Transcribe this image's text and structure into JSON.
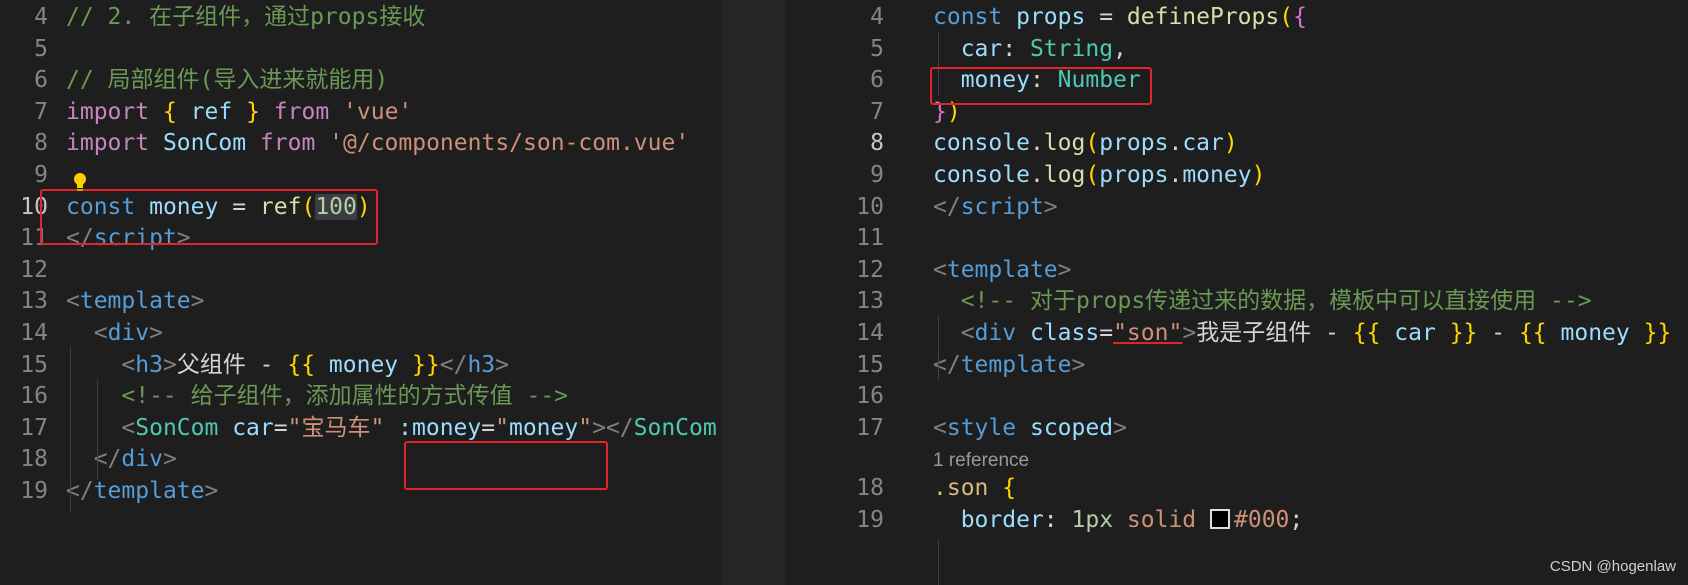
{
  "left": {
    "lines": [
      {
        "n": "4",
        "parts": [
          [
            "cmt",
            "// 2. 在子组件，通过props接收"
          ]
        ]
      },
      {
        "n": "5",
        "parts": []
      },
      {
        "n": "6",
        "parts": [
          [
            "cmt",
            "// 局部组件(导入进来就能用)"
          ]
        ]
      },
      {
        "n": "7",
        "parts": [
          [
            "ctl",
            "import"
          ],
          [
            "plain",
            " "
          ],
          [
            "br1",
            "{"
          ],
          [
            "plain",
            " "
          ],
          [
            "var",
            "ref"
          ],
          [
            "plain",
            " "
          ],
          [
            "br1",
            "}"
          ],
          [
            "plain",
            " "
          ],
          [
            "ctl",
            "from"
          ],
          [
            "plain",
            " "
          ],
          [
            "str",
            "'vue'"
          ]
        ]
      },
      {
        "n": "8",
        "parts": [
          [
            "ctl",
            "import"
          ],
          [
            "plain",
            " "
          ],
          [
            "var",
            "SonCom"
          ],
          [
            "plain",
            " "
          ],
          [
            "ctl",
            "from"
          ],
          [
            "plain",
            " "
          ],
          [
            "str",
            "'@/components/son-com.vue'"
          ]
        ]
      },
      {
        "n": "9",
        "parts": []
      },
      {
        "n": "10",
        "parts": [
          [
            "kw",
            "const"
          ],
          [
            "plain",
            " "
          ],
          [
            "var",
            "money"
          ],
          [
            "plain",
            " = "
          ],
          [
            "fn",
            "ref"
          ],
          [
            "br1",
            "("
          ],
          [
            "num",
            "100"
          ],
          [
            "br1",
            ")"
          ]
        ]
      },
      {
        "n": "11",
        "parts": [
          [
            "ang",
            "</"
          ],
          [
            "tag",
            "script"
          ],
          [
            "ang",
            ">"
          ]
        ]
      },
      {
        "n": "12",
        "parts": []
      },
      {
        "n": "13",
        "parts": [
          [
            "ang",
            "<"
          ],
          [
            "tag",
            "template"
          ],
          [
            "ang",
            ">"
          ]
        ]
      },
      {
        "n": "14",
        "parts": [
          [
            "plain",
            "  "
          ],
          [
            "ang",
            "<"
          ],
          [
            "tag",
            "div"
          ],
          [
            "ang",
            ">"
          ]
        ]
      },
      {
        "n": "15",
        "parts": [
          [
            "plain",
            "    "
          ],
          [
            "ang",
            "<"
          ],
          [
            "tag",
            "h3"
          ],
          [
            "ang",
            ">"
          ],
          [
            "plain",
            "父组件 - "
          ],
          [
            "br1",
            "{{"
          ],
          [
            "plain",
            " "
          ],
          [
            "var",
            "money"
          ],
          [
            "plain",
            " "
          ],
          [
            "br1",
            "}}"
          ],
          [
            "ang",
            "</"
          ],
          [
            "tag",
            "h3"
          ],
          [
            "ang",
            ">"
          ]
        ]
      },
      {
        "n": "16",
        "parts": [
          [
            "plain",
            "    "
          ],
          [
            "cmt",
            "<!-- 给子组件，添加属性的方式传值 -->"
          ]
        ]
      },
      {
        "n": "17",
        "parts": [
          [
            "plain",
            "    "
          ],
          [
            "ang",
            "<"
          ],
          [
            "cls",
            "SonCom"
          ],
          [
            "plain",
            " "
          ],
          [
            "var",
            "car"
          ],
          [
            "plain",
            "="
          ],
          [
            "str",
            "\"宝马车\""
          ],
          [
            "plain",
            " "
          ],
          [
            "var",
            ":money"
          ],
          [
            "plain",
            "="
          ],
          [
            "str",
            "\""
          ],
          [
            "var",
            "money"
          ],
          [
            "str",
            "\""
          ],
          [
            "ang",
            "></"
          ],
          [
            "cls",
            "SonCom"
          ]
        ]
      },
      {
        "n": "18",
        "parts": [
          [
            "plain",
            "  "
          ],
          [
            "ang",
            "</"
          ],
          [
            "tag",
            "div"
          ],
          [
            "ang",
            ">"
          ]
        ]
      },
      {
        "n": "19",
        "parts": [
          [
            "ang",
            "</"
          ],
          [
            "tag",
            "template"
          ],
          [
            "ang",
            ">"
          ]
        ]
      }
    ]
  },
  "right": {
    "lines": [
      {
        "n": "4",
        "parts": [
          [
            "kw",
            "const"
          ],
          [
            "plain",
            " "
          ],
          [
            "var",
            "props"
          ],
          [
            "plain",
            " = "
          ],
          [
            "fn",
            "defineProps"
          ],
          [
            "br1",
            "("
          ],
          [
            "br2",
            "{"
          ]
        ]
      },
      {
        "n": "5",
        "parts": [
          [
            "plain",
            "  "
          ],
          [
            "var",
            "car"
          ],
          [
            "plain",
            ": "
          ],
          [
            "typ",
            "String"
          ],
          [
            "plain",
            ","
          ]
        ]
      },
      {
        "n": "6",
        "parts": [
          [
            "plain",
            "  "
          ],
          [
            "var",
            "money"
          ],
          [
            "plain",
            ": "
          ],
          [
            "typ",
            "Number"
          ]
        ]
      },
      {
        "n": "7",
        "parts": [
          [
            "br2",
            "}"
          ],
          [
            "br1",
            ")"
          ]
        ]
      },
      {
        "n": "8",
        "parts": [
          [
            "var",
            "console"
          ],
          [
            "plain",
            "."
          ],
          [
            "fn",
            "log"
          ],
          [
            "br1",
            "("
          ],
          [
            "var",
            "props"
          ],
          [
            "plain",
            "."
          ],
          [
            "var",
            "car"
          ],
          [
            "br1",
            ")"
          ]
        ]
      },
      {
        "n": "9",
        "parts": [
          [
            "var",
            "console"
          ],
          [
            "plain",
            "."
          ],
          [
            "fn",
            "log"
          ],
          [
            "br1",
            "("
          ],
          [
            "var",
            "props"
          ],
          [
            "plain",
            "."
          ],
          [
            "var",
            "money"
          ],
          [
            "br1",
            ")"
          ]
        ]
      },
      {
        "n": "10",
        "parts": [
          [
            "ang",
            "</"
          ],
          [
            "tag",
            "script"
          ],
          [
            "ang",
            ">"
          ]
        ]
      },
      {
        "n": "11",
        "parts": []
      },
      {
        "n": "12",
        "parts": [
          [
            "ang",
            "<"
          ],
          [
            "tag",
            "template"
          ],
          [
            "ang",
            ">"
          ]
        ]
      },
      {
        "n": "13",
        "parts": [
          [
            "plain",
            "  "
          ],
          [
            "cmt",
            "<!-- 对于props传递过来的数据，模板中可以直接使用 -->"
          ]
        ]
      },
      {
        "n": "14",
        "parts": [
          [
            "plain",
            "  "
          ],
          [
            "ang",
            "<"
          ],
          [
            "tag",
            "div"
          ],
          [
            "plain",
            " "
          ],
          [
            "var",
            "class"
          ],
          [
            "plain",
            "="
          ],
          [
            "str",
            "\"son\""
          ],
          [
            "ang",
            ">"
          ],
          [
            "plain",
            "我是子组件 - "
          ],
          [
            "br1",
            "{{"
          ],
          [
            "plain",
            " "
          ],
          [
            "var",
            "car"
          ],
          [
            "plain",
            " "
          ],
          [
            "br1",
            "}}"
          ],
          [
            "plain",
            " - "
          ],
          [
            "br1",
            "{{"
          ],
          [
            "plain",
            " "
          ],
          [
            "var",
            "money"
          ],
          [
            "plain",
            " "
          ],
          [
            "br1",
            "}}"
          ]
        ]
      },
      {
        "n": "15",
        "parts": [
          [
            "ang",
            "</"
          ],
          [
            "tag",
            "template"
          ],
          [
            "ang",
            ">"
          ]
        ]
      },
      {
        "n": "16",
        "parts": []
      },
      {
        "n": "17",
        "parts": [
          [
            "ang",
            "<"
          ],
          [
            "tag",
            "style"
          ],
          [
            "plain",
            " "
          ],
          [
            "var",
            "scoped"
          ],
          [
            "ang",
            ">"
          ]
        ]
      },
      {
        "n": "18",
        "parts": [
          [
            "sel",
            ".son"
          ],
          [
            "plain",
            " "
          ],
          [
            "br1",
            "{"
          ]
        ]
      },
      {
        "n": "19",
        "parts": [
          [
            "plain",
            "  "
          ],
          [
            "var",
            "border"
          ],
          [
            "plain",
            ": "
          ],
          [
            "num",
            "1px"
          ],
          [
            "plain",
            " "
          ],
          [
            "str",
            "solid"
          ],
          [
            "plain",
            " "
          ],
          [
            "swatch",
            ""
          ],
          [
            "str",
            "#000"
          ],
          [
            "plain",
            ";"
          ]
        ]
      }
    ],
    "codelens": "1 reference"
  },
  "watermark": "CSDN @hogenlaw"
}
